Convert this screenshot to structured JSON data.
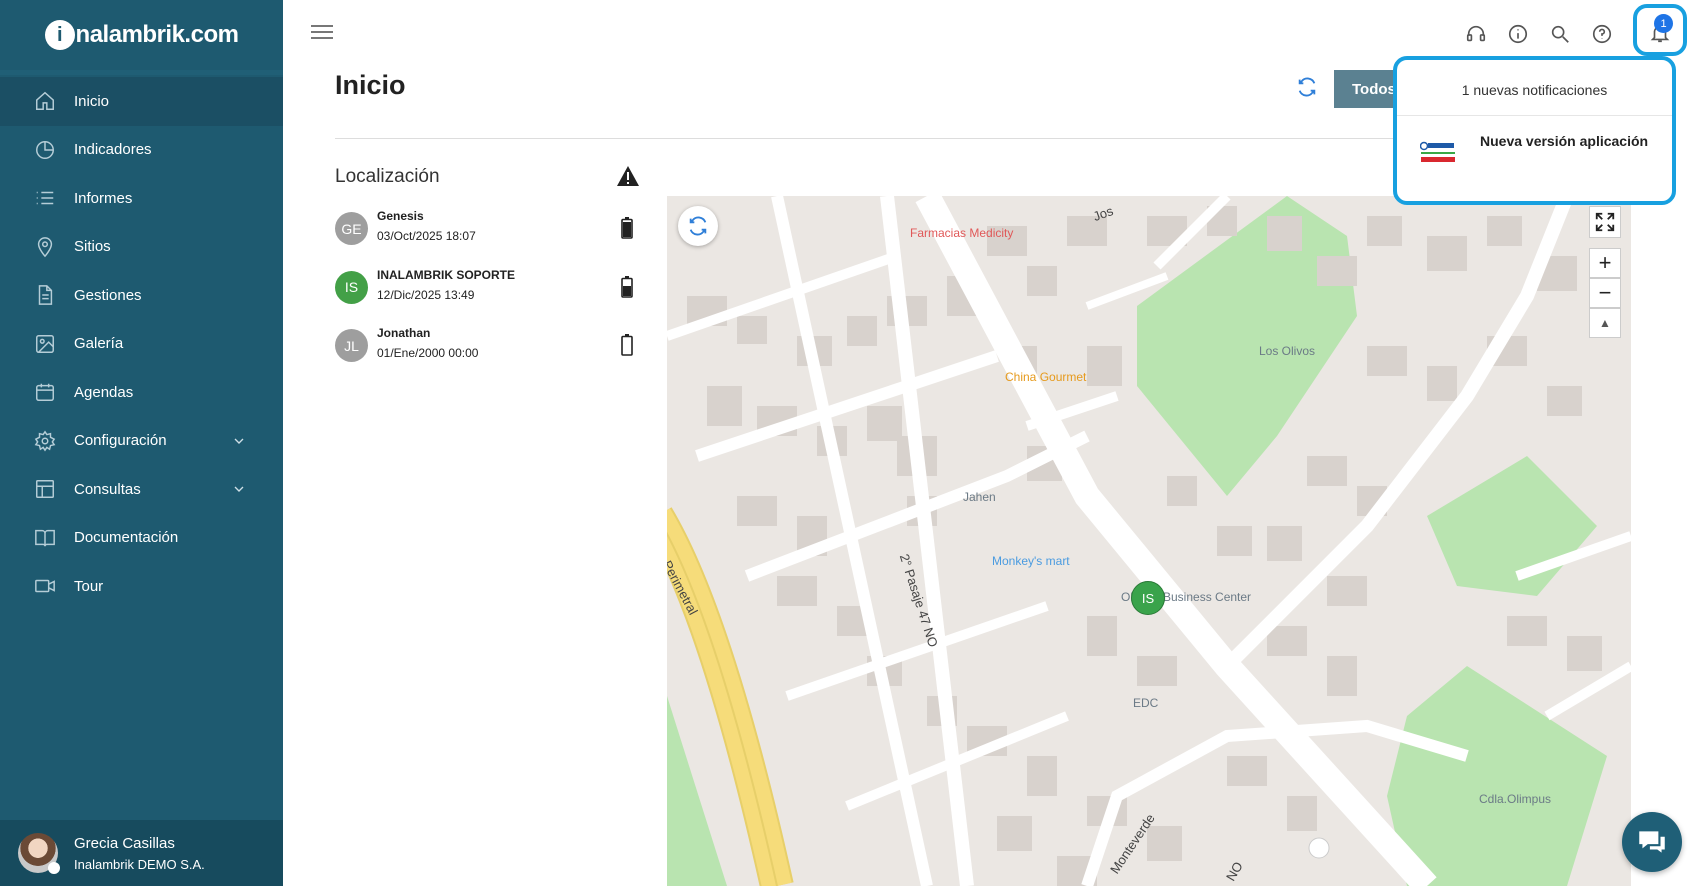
{
  "brand": {
    "logo_text": "nalambrik.com",
    "logo_initial": "i"
  },
  "sidebar": {
    "items": [
      {
        "label": "Inicio",
        "icon": "home-icon",
        "active": true
      },
      {
        "label": "Indicadores",
        "icon": "pie-chart-icon"
      },
      {
        "label": "Informes",
        "icon": "list-icon"
      },
      {
        "label": "Sitios",
        "icon": "map-pin-icon"
      },
      {
        "label": "Gestiones",
        "icon": "document-icon"
      },
      {
        "label": "Galería",
        "icon": "image-icon"
      },
      {
        "label": "Agendas",
        "icon": "calendar-icon"
      },
      {
        "label": "Configuración",
        "icon": "gear-icon",
        "expandable": true
      },
      {
        "label": "Consultas",
        "icon": "table-icon",
        "expandable": true
      },
      {
        "label": "Documentación",
        "icon": "book-icon"
      },
      {
        "label": "Tour",
        "icon": "video-icon"
      }
    ],
    "user": {
      "name": "Grecia Casillas",
      "company": "Inalambrik DEMO S.A."
    }
  },
  "header": {
    "title": "Inicio",
    "filter_button": "Todos",
    "notification_count": "1",
    "icons": [
      "support-icon",
      "info-icon",
      "search-icon",
      "help-icon",
      "bell-icon"
    ]
  },
  "location": {
    "title": "Localización",
    "devices": [
      {
        "initials": "GE",
        "name": "Genesis",
        "datetime": "03/Oct/2025 18:07",
        "avatar_color": "#9e9e9e",
        "battery": 0.85
      },
      {
        "initials": "IS",
        "name": "INALAMBRIK SOPORTE",
        "datetime": "12/Dic/2025 13:49",
        "avatar_color": "#43a047",
        "battery": 0.6
      },
      {
        "initials": "JL",
        "name": "Jonathan",
        "datetime": "01/Ene/2000 00:00",
        "avatar_color": "#9e9e9e",
        "battery": 0.0
      }
    ]
  },
  "map": {
    "marker_label": "IS",
    "pois": [
      {
        "label": "Farmacias Medicity",
        "color": "#e05858"
      },
      {
        "label": "China Gourmet",
        "color": "#e69a1c"
      },
      {
        "label": "Los Olivos",
        "color": "#6b7a86"
      },
      {
        "label": "Jahen",
        "color": "#6b7a86"
      },
      {
        "label": "Monkey's mart",
        "color": "#4a9be0"
      },
      {
        "label": "Ol",
        "color": "#6b7a86"
      },
      {
        "label": "Business Center",
        "color": "#6b7a86"
      },
      {
        "label": "EDC",
        "color": "#6b7a86"
      },
      {
        "label": "Cdla.Olimpus",
        "color": "#6b7a86"
      }
    ],
    "streets": [
      "2° Pasaje 47 NO",
      "Perimetral",
      "Jos",
      "Monteverde",
      "NO"
    ],
    "controls": {
      "zoom_in": "+",
      "zoom_out": "−",
      "compass": "▲"
    }
  },
  "notifications": {
    "header": "1 nuevas notificaciones",
    "items": [
      {
        "title": "Nueva versión aplicación"
      }
    ]
  }
}
